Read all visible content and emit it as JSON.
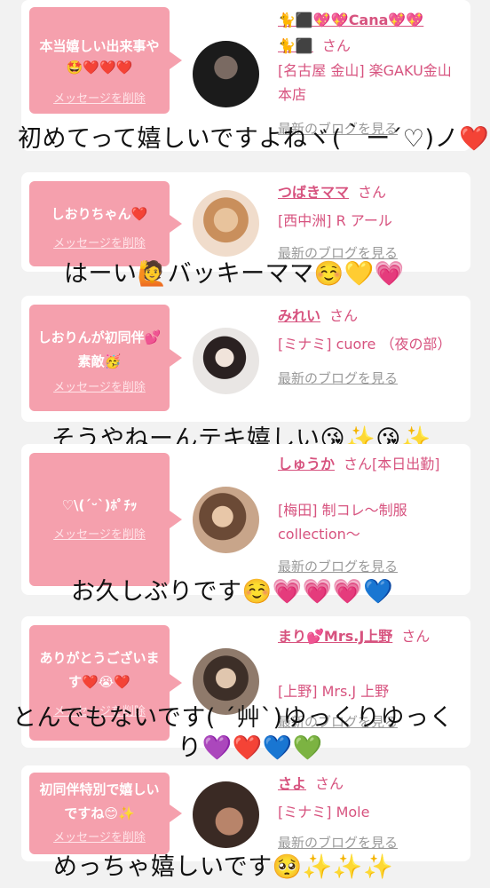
{
  "cards": [
    {
      "message": "本当嬉しい出来事や🤩❤️❤️❤️",
      "delete_label": "メッセージを削除",
      "name": "🐈⬛💖💖Cana💖💖",
      "name_sub": "🐈⬛",
      "honorific": "さん",
      "shop": "[名古屋 金山] 楽GAKU金山本店",
      "blog_label": "最新のブログを見る",
      "reply": "初めてって嬉しいですよねヾ(｀ー´♡)ノ❤️"
    },
    {
      "message": "しおりちゃん❤️",
      "delete_label": "メッセージを削除",
      "name": "つばきママ",
      "honorific": "さん",
      "shop": "[西中洲] R アール",
      "blog_label": "最新のブログを見る",
      "reply": "はーい🙋バッキーママ☺️💛💗"
    },
    {
      "message": "しおりんが初同伴💕素敵🥳",
      "delete_label": "メッセージを削除",
      "name": "みれい",
      "honorific": "さん",
      "shop": "[ミナミ] cuore （夜の部）",
      "blog_label": "最新のブログを見る",
      "reply": "そうやねーんテキ嬉しい😘✨😘✨"
    },
    {
      "message": "♡\\(ˊᵕˋ)ﾎﾟﾁｯ",
      "delete_label": "メッセージを削除",
      "name": "しゅうか",
      "honorific": "さん[本日出勤]",
      "shop": "[梅田] 制コレ～制服collection～",
      "blog_label": "最新のブログを見る",
      "reply": "お久しぶりです☺️💗💗💗💙"
    },
    {
      "message": "ありがとうございます❤️😭❤️",
      "delete_label": "メッセージを削除",
      "name": "まり💕Mrs.J上野",
      "honorific": "さん",
      "shop": "[上野] Mrs.J 上野",
      "blog_label": "最新のブログを見る",
      "reply_line1": "とんでもないです( ˊ艸ˋ)ゆっくりゆっく",
      "reply_line2": "り💜❤️💙💚"
    },
    {
      "message": "初同伴特別で嬉しいですね😊✨",
      "delete_label": "メッセージを削除",
      "name": "さよ",
      "honorific": "さん",
      "shop": "[ミナミ] Mole",
      "blog_label": "最新のブログを見る",
      "reply": "めっちゃ嬉しいです🥺✨✨✨"
    }
  ]
}
